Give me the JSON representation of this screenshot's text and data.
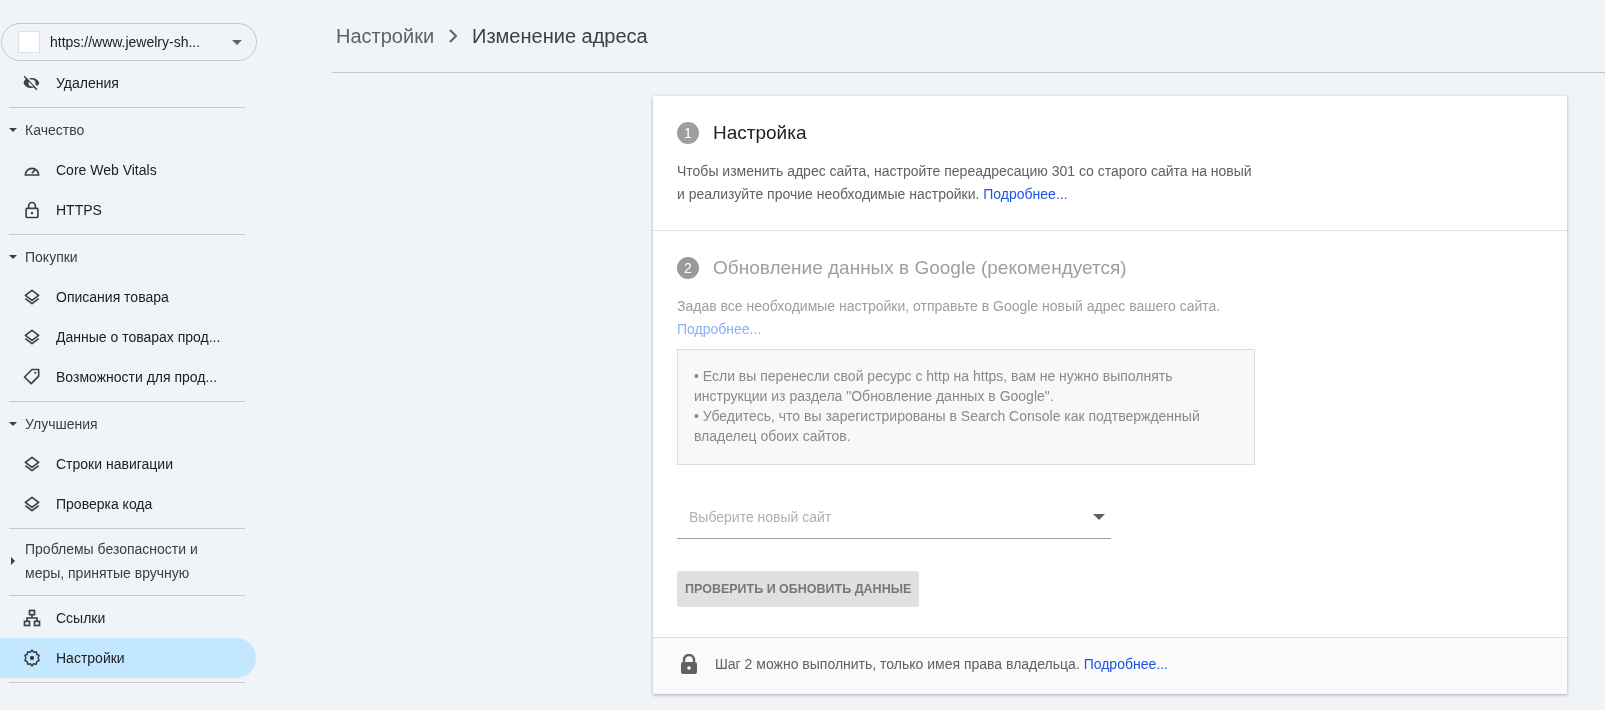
{
  "sidebar": {
    "property": {
      "label": "https://www.jewelry-sh..."
    },
    "sections": [
      {
        "items": [
          {
            "kind": "eye-off",
            "label": "Удаления",
            "selected": false
          }
        ]
      },
      {
        "title": "Качество",
        "expanded": true,
        "items": [
          {
            "kind": "gauge",
            "label": "Core Web Vitals",
            "selected": false
          },
          {
            "kind": "lock",
            "label": "HTTPS",
            "selected": false
          }
        ]
      },
      {
        "title": "Покупки",
        "expanded": true,
        "items": [
          {
            "kind": "layers",
            "label": "Описания товара",
            "selected": false
          },
          {
            "kind": "layers",
            "label": "Данные о товарах прод...",
            "selected": false
          },
          {
            "kind": "tag",
            "label": "Возможности для прод...",
            "selected": false
          }
        ]
      },
      {
        "title": "Улучшения",
        "expanded": true,
        "items": [
          {
            "kind": "layers",
            "label": "Строки навигации",
            "selected": false
          },
          {
            "kind": "layers",
            "label": "Проверка кода",
            "selected": false
          }
        ]
      },
      {
        "title": "Проблемы безопасности и меры, принятые вручную",
        "expanded": false
      },
      {
        "items": [
          {
            "kind": "links",
            "label": "Ссылки",
            "selected": false
          },
          {
            "kind": "gear",
            "label": "Настройки",
            "selected": true
          }
        ]
      }
    ]
  },
  "breadcrumb": [
    "Настройки",
    "Изменение адреса"
  ],
  "steps": [
    {
      "number": "1",
      "title": "Настройка",
      "disabled": false,
      "text": "Чтобы изменить адрес сайта, настройте переадресацию 301 со старого сайта на новый и реализуйте прочие необходимые настройки.",
      "link": "Подробнее..."
    },
    {
      "number": "2",
      "title": "Обновление данных в Google (рекомендуется)",
      "disabled": true,
      "text": "Задав все необходимые настройки, отправьте в Google новый адрес вашего сайта.",
      "link": "Подробнее...",
      "notes": [
        "• Если вы перенесли свой ресурс с http на https, вам не нужно выполнять инструкции из раздела \"Обновление данных в Google\".",
        "• Убедитесь, что вы зарегистрированы в Search Console как подтвержденный владелец обоих сайтов."
      ],
      "select": {
        "placeholder": "Выберите новый сайт"
      },
      "button": "ПРОВЕРИТЬ И ОБНОВИТЬ ДАННЫЕ"
    }
  ],
  "footer": {
    "text": "Шаг 2 можно выполнить, только имея права владельца.",
    "link": "Подробнее..."
  }
}
